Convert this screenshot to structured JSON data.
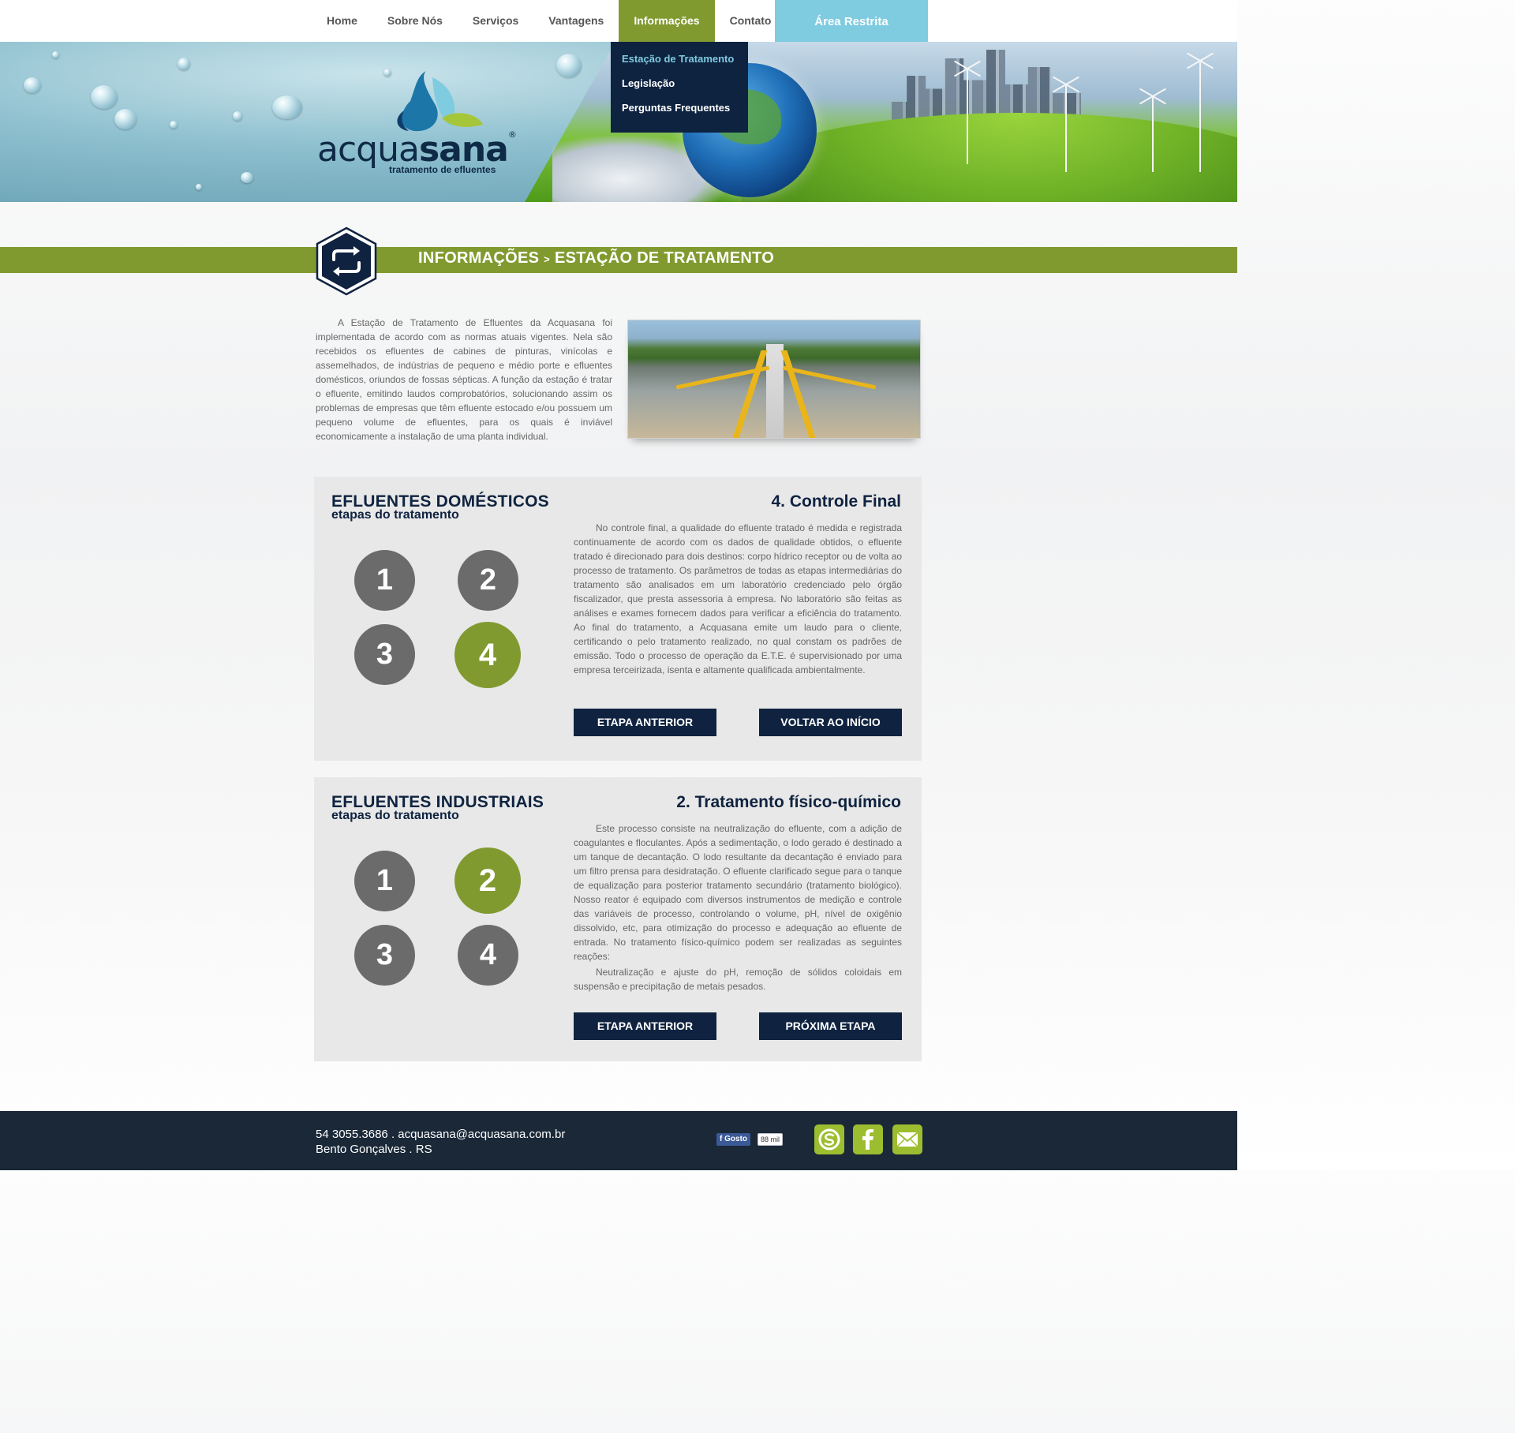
{
  "nav": {
    "items": [
      {
        "label": "Home"
      },
      {
        "label": "Sobre Nós"
      },
      {
        "label": "Serviços"
      },
      {
        "label": "Vantagens"
      },
      {
        "label": "Informações"
      },
      {
        "label": "Contato"
      }
    ],
    "restricted_label": "Área Restrita",
    "dropdown": [
      {
        "label": "Estação de Tratamento"
      },
      {
        "label": "Legislação"
      },
      {
        "label": "Perguntas Frequentes"
      }
    ]
  },
  "brand": {
    "name_light": "acqua",
    "name_bold": "sana",
    "registered": "®",
    "tagline": "tratamento de efluentes"
  },
  "page_title": {
    "section": "INFORMAÇÕES",
    "separator": ">",
    "page": "ESTAÇÃO DE TRATAMENTO"
  },
  "intro": {
    "text": "A Estação de Tratamento de Efluentes da Acquasana foi implementada de acordo com as normas atuais vigentes. Nela são recebidos os efluentes de cabines de pinturas, vinícolas e assemelhados, de indústrias de pequeno e médio porte e efluentes domésticos, oriundos de fossas sépticas. A função da estação é tratar o efluente, emitindo laudos comprobatórios, solucionando assim os problemas de empresas que têm efluente estocado e/ou possuem um pequeno volume de efluentes, para os quais é inviável economicamente a instalação de uma planta individual."
  },
  "domestic": {
    "title": "EFLUENTES DOMÉSTICOS",
    "subtitle": "etapas do tratamento",
    "steps": [
      "1",
      "2",
      "3",
      "4"
    ],
    "active_step": "4",
    "step_title": "4. Controle Final",
    "paragraphs": [
      "No controle final, a qualidade do efluente tratado é medida e registrada continuamente de acordo com os dados de qualidade obtidos, o efluente tratado é direcionado para dois destinos: corpo hídrico receptor ou de volta ao processo de tratamento. Os parâmetros de todas as etapas intermediárias do tratamento são analisados em um laboratório credenciado pelo órgão fiscalizador, que presta assessoria à empresa. No laboratório são feitas as análises e exames fornecem dados para verificar a eficiência do tratamento. Ao final do tratamento, a Acquasana emite um laudo para o cliente, certificando o pelo tratamento realizado, no qual constam os padrões de emissão. Todo o processo de operação da E.T.E. é supervisionado por uma empresa terceirizada, isenta e altamente qualificada ambientalmente."
    ],
    "btn_prev": "ETAPA ANTERIOR",
    "btn_next": "VOLTAR AO INÍCIO"
  },
  "industrial": {
    "title": "EFLUENTES INDUSTRIAIS",
    "subtitle": "etapas do tratamento",
    "steps": [
      "1",
      "2",
      "3",
      "4"
    ],
    "active_step": "2",
    "step_title": "2. Tratamento físico-químico",
    "paragraphs": [
      "Este processo consiste na neutralização do efluente, com a adição de coagulantes e floculantes. Após a sedimentação, o lodo gerado é destinado a um tanque de decantação. O lodo resultante da decantação é enviado para um filtro prensa para desidratação. O efluente clarificado segue para o tanque de equalização para posterior tratamento secundário (tratamento biológico). Nosso reator é equipado com diversos instrumentos de medição e controle das variáveis de processo, controlando o volume, pH, nível de oxigênio dissolvido, etc, para otimização do processo e adequação ao efluente de entrada. No tratamento físico-químico podem ser realizadas as seguintes reações:",
      "Neutralização e ajuste do pH, remoção de sólidos coloidais em suspensão e precipitação de metais pesados."
    ],
    "btn_prev": "ETAPA ANTERIOR",
    "btn_next": "PRÓXIMA ETAPA"
  },
  "footer": {
    "phone": "54 3055.3686",
    "dot": ".",
    "email": "acquasana@acquasana.com.br",
    "city": "Bento Gonçalves",
    "state": "RS",
    "fb_like": "Gosto",
    "fb_count": "88 mil"
  },
  "social": [
    "skype-icon",
    "facebook-icon",
    "mail-icon"
  ],
  "colors": {
    "accent_green": "#819a30",
    "navy": "#0f2340",
    "light_blue": "#7fcbe0",
    "footer_bg": "#1a2838",
    "step_grey": "#6b6b6b"
  }
}
